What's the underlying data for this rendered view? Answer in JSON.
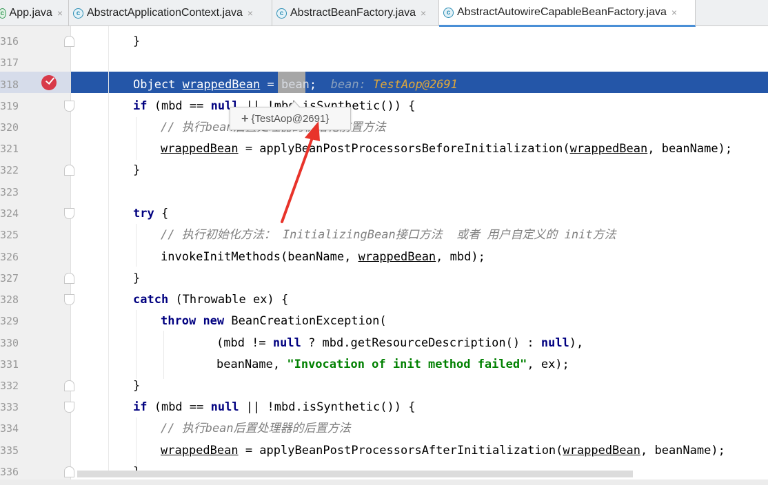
{
  "tabs": [
    {
      "label": "App.java",
      "icon": "app-class-icon",
      "active": false
    },
    {
      "label": "AbstractApplicationContext.java",
      "icon": "class-icon",
      "active": false
    },
    {
      "label": "AbstractBeanFactory.java",
      "icon": "class-icon",
      "active": false
    },
    {
      "label": "AbstractAutowireCapableBeanFactory.java",
      "icon": "class-icon",
      "active": true
    }
  ],
  "close_glyph": "×",
  "line_numbers": [
    "316",
    "317",
    "318",
    "319",
    "320",
    "321",
    "322",
    "323",
    "324",
    "325",
    "326",
    "327",
    "328",
    "329",
    "330",
    "331",
    "332",
    "333",
    "334",
    "335",
    "336"
  ],
  "code": {
    "l316": "}",
    "l318_a": "Object ",
    "l318_b": "wrappedBean",
    "l318_c": " = ",
    "l318_d": "bean",
    "l318_e": ";",
    "l318_debug_name": "bean: ",
    "l318_debug_value": "TestAop@2691",
    "l319_kw1": "if",
    "l319_a": " (mbd == ",
    "l319_kw2": "null",
    "l319_b": " || !mbd.isSynthetic()) {",
    "l320": "// 执行bean后置处理器的初始化前置方法",
    "l321_a": "wrappedBean",
    "l321_b": " = applyBeanPostProcessorsBeforeInitialization(",
    "l321_c": "wrappedBean",
    "l321_d": ", beanName);",
    "l322": "}",
    "l324_kw": "try",
    "l324_a": " {",
    "l325": "// 执行初始化方法： InitializingBean接口方法  或者 用户自定义的 init方法",
    "l326_a": "invokeInitMethods(beanName, ",
    "l326_b": "wrappedBean",
    "l326_c": ", mbd);",
    "l327": "}",
    "l328_kw": "catch",
    "l328_a": " (Throwable ex) {",
    "l329_kw1": "throw",
    "l329_kw2": "new",
    "l329_a": " BeanCreationException(",
    "l330_a": "(mbd != ",
    "l330_kw1": "null",
    "l330_b": " ? mbd.getResourceDescription() : ",
    "l330_kw2": "null",
    "l330_c": "),",
    "l331_a": "beanName, ",
    "l331_str": "\"Invocation of init method failed\"",
    "l331_b": ", ex);",
    "l332": "}",
    "l333_kw1": "if",
    "l333_a": " (mbd == ",
    "l333_kw2": "null",
    "l333_b": " || !mbd.isSynthetic()) {",
    "l334": "// 执行bean后置处理器的后置方法",
    "l335_a": "wrappedBean",
    "l335_b": " = applyBeanPostProcessorsAfterInitialization(",
    "l335_c": "wrappedBean",
    "l335_d": ", beanName);",
    "l336": "}"
  },
  "tooltip": {
    "plus": "+",
    "text": "{TestAop@2691}"
  },
  "colors": {
    "highlight": "#2456a8",
    "keyword": "#000080",
    "comment": "#808080",
    "string": "#008000",
    "debug_value": "#e0a83a",
    "arrow": "#e8332a"
  }
}
